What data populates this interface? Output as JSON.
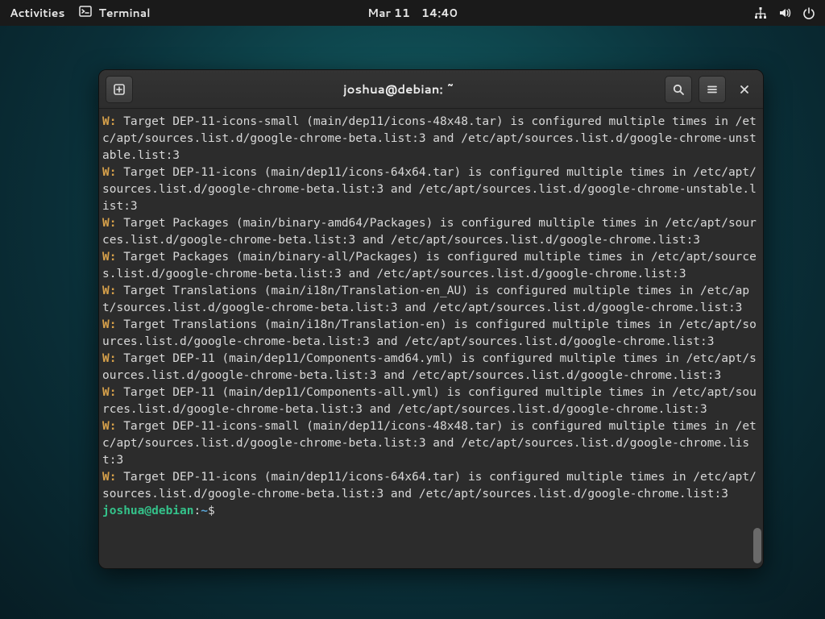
{
  "topbar": {
    "activities": "Activities",
    "app_label": "Terminal",
    "date": "Mar 11",
    "time": "14:40"
  },
  "window": {
    "title": "joshua@debian: ~"
  },
  "terminal": {
    "warnings": [
      "Target DEP-11-icons-small (main/dep11/icons-48x48.tar) is configured multiple times in /etc/apt/sources.list.d/google-chrome-beta.list:3 and /etc/apt/sources.list.d/google-chrome-unstable.list:3",
      "Target DEP-11-icons (main/dep11/icons-64x64.tar) is configured multiple times in /etc/apt/sources.list.d/google-chrome-beta.list:3 and /etc/apt/sources.list.d/google-chrome-unstable.list:3",
      "Target Packages (main/binary-amd64/Packages) is configured multiple times in /etc/apt/sources.list.d/google-chrome-beta.list:3 and /etc/apt/sources.list.d/google-chrome.list:3",
      "Target Packages (main/binary-all/Packages) is configured multiple times in /etc/apt/sources.list.d/google-chrome-beta.list:3 and /etc/apt/sources.list.d/google-chrome.list:3",
      "Target Translations (main/i18n/Translation-en_AU) is configured multiple times in /etc/apt/sources.list.d/google-chrome-beta.list:3 and /etc/apt/sources.list.d/google-chrome.list:3",
      "Target Translations (main/i18n/Translation-en) is configured multiple times in /etc/apt/sources.list.d/google-chrome-beta.list:3 and /etc/apt/sources.list.d/google-chrome.list:3",
      "Target DEP-11 (main/dep11/Components-amd64.yml) is configured multiple times in /etc/apt/sources.list.d/google-chrome-beta.list:3 and /etc/apt/sources.list.d/google-chrome.list:3",
      "Target DEP-11 (main/dep11/Components-all.yml) is configured multiple times in /etc/apt/sources.list.d/google-chrome-beta.list:3 and /etc/apt/sources.list.d/google-chrome.list:3",
      "Target DEP-11-icons-small (main/dep11/icons-48x48.tar) is configured multiple times in /etc/apt/sources.list.d/google-chrome-beta.list:3 and /etc/apt/sources.list.d/google-chrome.list:3",
      "Target DEP-11-icons (main/dep11/icons-64x64.tar) is configured multiple times in /etc/apt/sources.list.d/google-chrome-beta.list:3 and /etc/apt/sources.list.d/google-chrome.list:3"
    ],
    "prompt_user": "joshua@debian",
    "prompt_sep": ":",
    "prompt_path": "~",
    "prompt_suffix": "$ "
  }
}
